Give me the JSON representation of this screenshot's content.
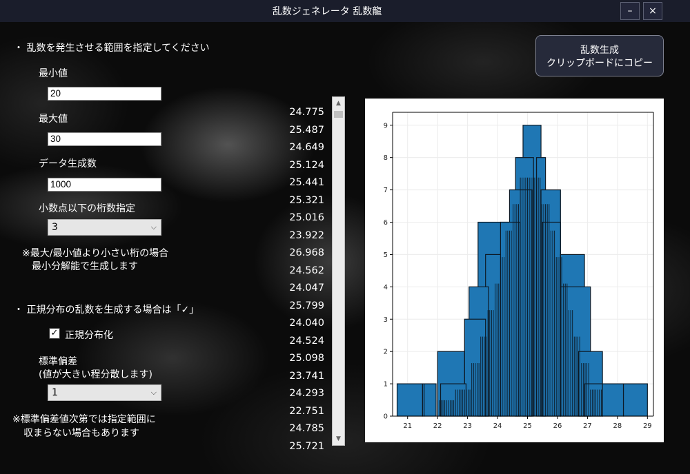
{
  "window": {
    "title": "乱数ジェネレータ 乱数龍",
    "minimize_label": "–",
    "close_label": "×"
  },
  "form": {
    "range_heading": "・ 乱数を発生させる範囲を指定してください",
    "min_label": "最小値",
    "min_value": "20",
    "max_label": "最大値",
    "max_value": "30",
    "count_label": "データ生成数",
    "count_value": "1000",
    "decimals_label": "小数点以下の桁数指定",
    "decimals_value": "3",
    "note1_line1": "※最大/最小値より小さい桁の場合",
    "note1_line2": "最小分解能で生成します",
    "normal_heading": "・ 正規分布の乱数を生成する場合は「✓」",
    "normal_checkbox_label": "正規分布化",
    "normal_checked": true,
    "stddev_label_line1": "標準偏差",
    "stddev_label_line2": "(値が大きい程分散します)",
    "stddev_value": "1",
    "note2_line1": "※標準偏差値次第では指定範囲に",
    "note2_line2": "収まらない場合もあります"
  },
  "generate_button": {
    "line1": "乱数生成",
    "line2": "クリップボードにコピー"
  },
  "results": [
    "24.775",
    "25.487",
    "24.649",
    "25.124",
    "25.441",
    "25.321",
    "25.016",
    "23.922",
    "26.968",
    "24.562",
    "24.047",
    "25.799",
    "24.040",
    "24.524",
    "25.098",
    "23.741",
    "24.293",
    "22.751",
    "24.785",
    "25.721"
  ],
  "chart_data": {
    "type": "bar",
    "xlim": [
      20.5,
      29.2
    ],
    "ylim": [
      0,
      9.4
    ],
    "x_ticks": [
      21,
      22,
      23,
      24,
      25,
      26,
      27,
      28,
      29
    ],
    "y_ticks": [
      0,
      1,
      2,
      3,
      4,
      5,
      6,
      7,
      8,
      9
    ],
    "bar_color": "#1f77b4",
    "bars": [
      {
        "x0": 20.65,
        "x1": 21.5,
        "y": 1
      },
      {
        "x0": 21.5,
        "x1": 21.55,
        "y": 1
      },
      {
        "x0": 21.55,
        "x1": 21.95,
        "y": 1
      },
      {
        "x0": 22.0,
        "x1": 22.9,
        "y": 2
      },
      {
        "x0": 22.1,
        "x1": 22.95,
        "y": 1
      },
      {
        "x0": 22.9,
        "x1": 23.6,
        "y": 3
      },
      {
        "x0": 23.05,
        "x1": 23.7,
        "y": 4
      },
      {
        "x0": 23.35,
        "x1": 24.35,
        "y": 6
      },
      {
        "x0": 23.6,
        "x1": 24.1,
        "y": 5
      },
      {
        "x0": 24.1,
        "x1": 24.75,
        "y": 6
      },
      {
        "x0": 24.4,
        "x1": 25.15,
        "y": 7
      },
      {
        "x0": 24.6,
        "x1": 25.2,
        "y": 8
      },
      {
        "x0": 24.85,
        "x1": 25.45,
        "y": 9
      },
      {
        "x0": 25.3,
        "x1": 25.6,
        "y": 8
      },
      {
        "x0": 25.45,
        "x1": 26.1,
        "y": 7
      },
      {
        "x0": 25.5,
        "x1": 26.1,
        "y": 6
      },
      {
        "x0": 26.1,
        "x1": 26.9,
        "y": 5
      },
      {
        "x0": 26.1,
        "x1": 27.1,
        "y": 4
      },
      {
        "x0": 26.7,
        "x1": 27.5,
        "y": 2
      },
      {
        "x0": 26.9,
        "x1": 27.5,
        "y": 1
      },
      {
        "x0": 27.5,
        "x1": 28.2,
        "y": 1
      },
      {
        "x0": 28.2,
        "x1": 29.0,
        "y": 1
      }
    ],
    "dense_range": [
      22.0,
      27.5
    ]
  }
}
